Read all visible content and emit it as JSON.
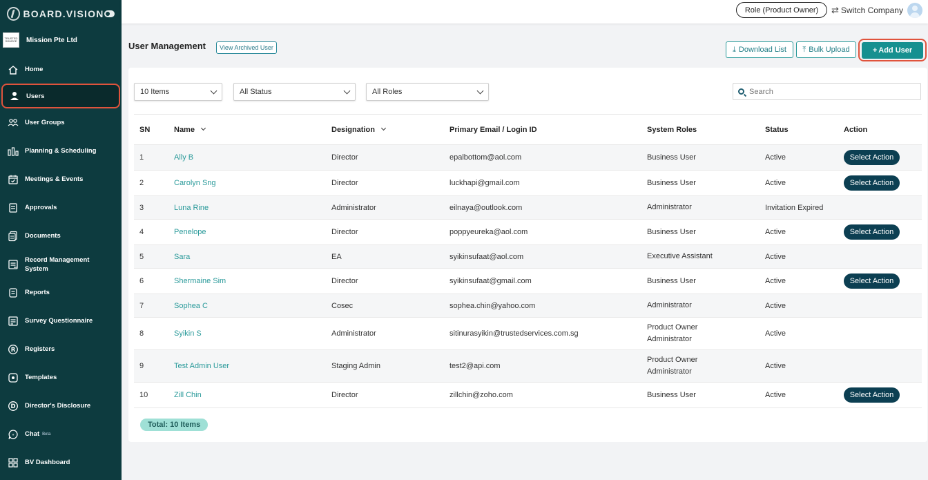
{
  "brand": {
    "name": "BOARD.VISION"
  },
  "company": {
    "name": "Mission Pte Ltd",
    "logo_text": "TRUSTED SOURCE"
  },
  "sidebar": {
    "items": [
      {
        "label": "Home",
        "icon": "home-icon"
      },
      {
        "label": "Users",
        "icon": "user-icon",
        "active": true
      },
      {
        "label": "User Groups",
        "icon": "user-group-icon"
      },
      {
        "label": "Planning & Scheduling",
        "icon": "planning-icon"
      },
      {
        "label": "Meetings & Events",
        "icon": "calendar-icon"
      },
      {
        "label": "Approvals",
        "icon": "approvals-icon"
      },
      {
        "label": "Documents",
        "icon": "documents-icon"
      },
      {
        "label": "Record Management System",
        "icon": "records-icon"
      },
      {
        "label": "Reports",
        "icon": "reports-icon"
      },
      {
        "label": "Survey Questionnaire",
        "icon": "survey-icon"
      },
      {
        "label": "Registers",
        "icon": "registers-icon"
      },
      {
        "label": "Templates",
        "icon": "templates-icon"
      },
      {
        "label": "Director's Disclosure",
        "icon": "disclosure-icon"
      },
      {
        "label": "Chat",
        "icon": "chat-icon",
        "badge": "Beta"
      },
      {
        "label": "BV Dashboard",
        "icon": "dashboard-icon"
      }
    ]
  },
  "topbar": {
    "role_label": "Role (Product Owner)",
    "switch_label": "Switch Company"
  },
  "header": {
    "title": "User Management",
    "archived_label": "View Archived User",
    "download_label": "Download List",
    "bulk_label": "Bulk Upload",
    "add_label": "Add User"
  },
  "filters": {
    "items_value": "10 Items",
    "status_value": "All Status",
    "roles_value": "All Roles",
    "search_placeholder": "Search"
  },
  "table": {
    "headers": {
      "sn": "SN",
      "name": "Name",
      "designation": "Designation",
      "email": "Primary Email / Login ID",
      "roles": "System Roles",
      "status": "Status",
      "action": "Action"
    },
    "rows": [
      {
        "sn": "1",
        "name": "Ally B",
        "designation": "Director",
        "email": "epalbottom@aol.com",
        "roles": [
          "Business User"
        ],
        "status": "Active",
        "action": "Select Action"
      },
      {
        "sn": "2",
        "name": "Carolyn Sng",
        "designation": "Director",
        "email": "luckhapi@gmail.com",
        "roles": [
          "Business User"
        ],
        "status": "Active",
        "action": "Select Action"
      },
      {
        "sn": "3",
        "name": "Luna Rine",
        "designation": "Administrator",
        "email": "eilnaya@outlook.com",
        "roles": [
          "Administrator"
        ],
        "status": "Invitation Expired",
        "action": ""
      },
      {
        "sn": "4",
        "name": "Penelope",
        "designation": "Director",
        "email": "poppyeureka@aol.com",
        "roles": [
          "Business User"
        ],
        "status": "Active",
        "action": "Select Action"
      },
      {
        "sn": "5",
        "name": "Sara",
        "designation": "EA",
        "email": "syikinsufaat@aol.com",
        "roles": [
          "Executive Assistant"
        ],
        "status": "Active",
        "action": ""
      },
      {
        "sn": "6",
        "name": "Shermaine Sim",
        "designation": "Director",
        "email": "syikinsufaat@gmail.com",
        "roles": [
          "Business User"
        ],
        "status": "Active",
        "action": "Select Action"
      },
      {
        "sn": "7",
        "name": "Sophea C",
        "designation": "Cosec",
        "email": "sophea.chin@yahoo.com",
        "roles": [
          "Administrator"
        ],
        "status": "Active",
        "action": ""
      },
      {
        "sn": "8",
        "name": "Syikin S",
        "designation": "Administrator",
        "email": "sitinurasyikin@trustedservices.com.sg",
        "roles": [
          "Product Owner",
          "Administrator"
        ],
        "status": "Active",
        "action": ""
      },
      {
        "sn": "9",
        "name": "Test Admin User",
        "designation": "Staging Admin",
        "email": "test2@api.com",
        "roles": [
          "Product Owner",
          "Administrator"
        ],
        "status": "Active",
        "action": ""
      },
      {
        "sn": "10",
        "name": "Zill Chin",
        "designation": "Director",
        "email": "zillchin@zoho.com",
        "roles": [
          "Business User"
        ],
        "status": "Active",
        "action": "Select Action"
      }
    ]
  },
  "footer": {
    "total": "Total: 10 Items"
  },
  "colors": {
    "sidebar": "#0d3b3f",
    "accent": "#169090",
    "highlight": "#e0533c",
    "action": "#0c3f52"
  }
}
